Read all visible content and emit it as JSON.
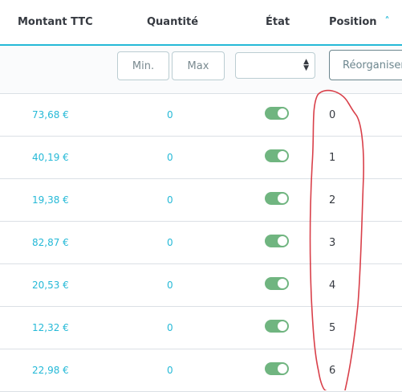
{
  "table": {
    "columns": {
      "amount": "Montant TTC",
      "quantity": "Quantité",
      "state": "État",
      "position": "Position",
      "position_sort_icon": "˄"
    },
    "filters": {
      "min_placeholder": "Min.",
      "max_placeholder": "Max",
      "state_select_value": "",
      "reorder_button": "Réorganiser"
    },
    "rows": [
      {
        "amount": "73,68 €",
        "quantity": "0",
        "state": true,
        "position": "0"
      },
      {
        "amount": "40,19 €",
        "quantity": "0",
        "state": true,
        "position": "1"
      },
      {
        "amount": "19,38 €",
        "quantity": "0",
        "state": true,
        "position": "2"
      },
      {
        "amount": "82,87 €",
        "quantity": "0",
        "state": true,
        "position": "3"
      },
      {
        "amount": "20,53 €",
        "quantity": "0",
        "state": true,
        "position": "4"
      },
      {
        "amount": "12,32 €",
        "quantity": "0",
        "state": true,
        "position": "5"
      },
      {
        "amount": "22,98 €",
        "quantity": "0",
        "state": true,
        "position": "6"
      }
    ]
  },
  "colors": {
    "accent": "#25b9d7",
    "toggle_on": "#70b580",
    "annotation": "#d9404a"
  },
  "icons": {
    "sort": "sort-ascending-icon",
    "select_caret": "select-caret-icon",
    "toggle": "toggle-on-icon"
  }
}
